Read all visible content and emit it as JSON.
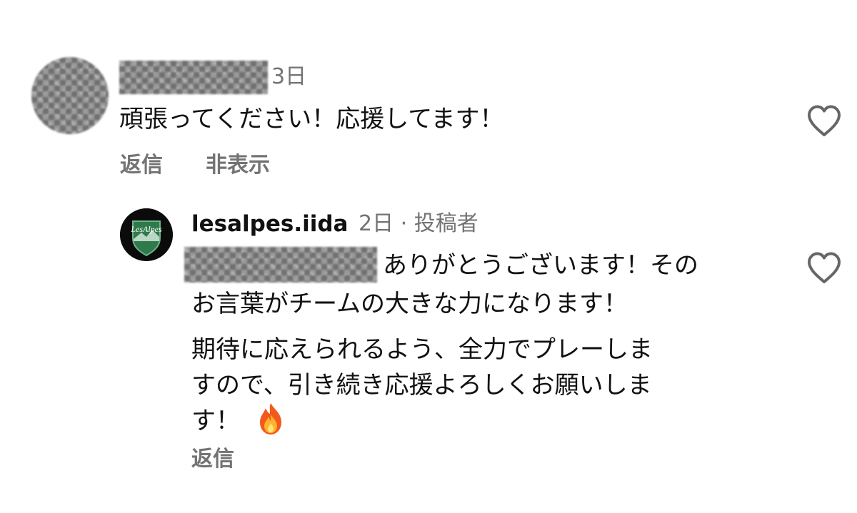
{
  "comment": {
    "time": "3日",
    "text": "頑張ってください！応援してます！",
    "actions": {
      "reply": "返信",
      "hide": "非表示"
    },
    "like_icon": "heart-outline-icon"
  },
  "reply": {
    "username": "lesalpes.iida",
    "meta": "2日 · 投稿者",
    "avatar_text": "LesAlpes",
    "lines": [
      "ありがとうございます！その",
      "お言葉がチームの大きな力になります！",
      "期待に応えられるよう、全力でプレーしま",
      "すので、引き続き応援よろしくお願いしま",
      "す！"
    ],
    "emoji_icon": "fire-icon",
    "actions": {
      "reply": "返信"
    },
    "like_icon": "heart-outline-icon"
  }
}
